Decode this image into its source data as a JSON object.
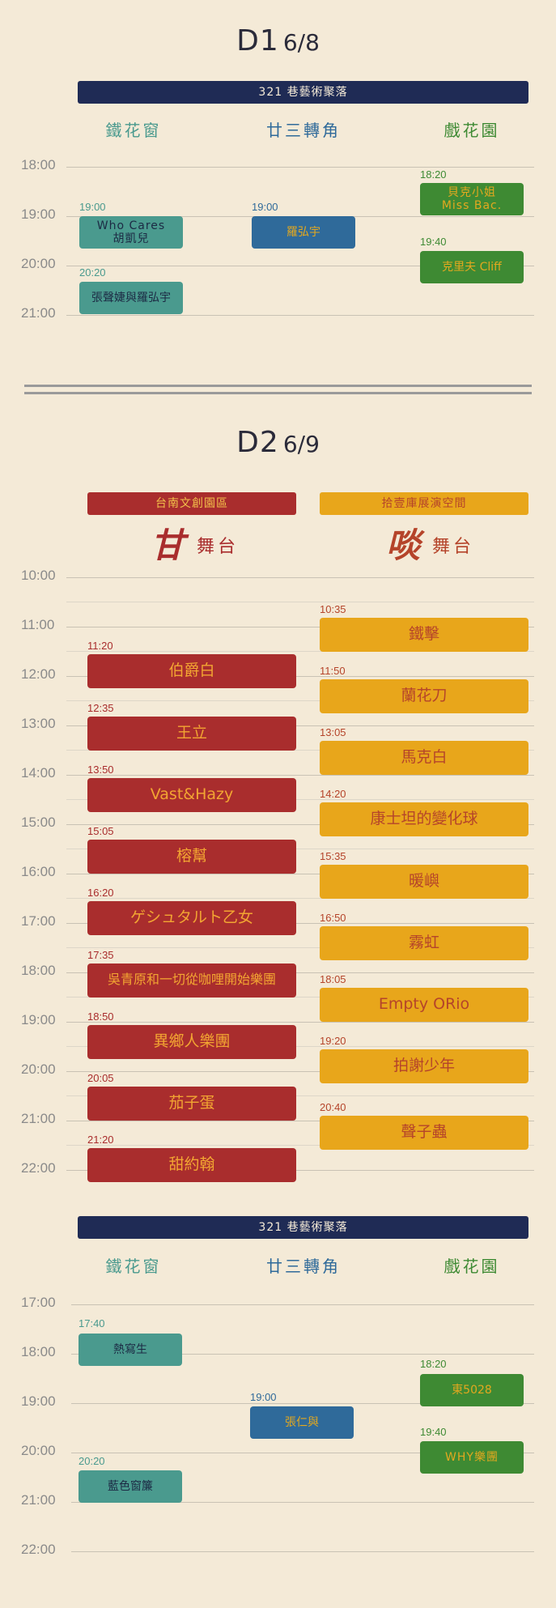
{
  "d1": {
    "title": "D1",
    "date": "6/8",
    "venue": "321 巷藝術聚落",
    "stages": [
      "鐵花窗",
      "廿三轉角",
      "戲花園"
    ],
    "times": [
      "18:00",
      "19:00",
      "20:00",
      "21:00"
    ],
    "slots": [
      {
        "time": "19:00",
        "line1": "Who Cares",
        "line2": "胡凱兒"
      },
      {
        "time": "20:20",
        "line1": "張聲婕與羅弘宇"
      },
      {
        "time": "19:00",
        "line1": "羅弘宇"
      },
      {
        "time": "18:20",
        "line1": "貝克小姐",
        "line2": "Miss Bac."
      },
      {
        "time": "19:40",
        "line1": "克里夫 Cliff"
      }
    ]
  },
  "d2": {
    "title": "D2",
    "date": "6/9",
    "venue_left": "台南文創園區",
    "venue_right": "拾壹庫展演空間",
    "stage_left_glyph": "甘",
    "stage_left_name": "舞台",
    "stage_right_glyph": "啖",
    "stage_right_name": "舞台",
    "times": [
      "10:00",
      "11:00",
      "12:00",
      "13:00",
      "14:00",
      "15:00",
      "16:00",
      "17:00",
      "18:00",
      "19:00",
      "20:00",
      "21:00",
      "22:00"
    ],
    "left": [
      {
        "time": "11:20",
        "name": "伯爵白"
      },
      {
        "time": "12:35",
        "name": "王立"
      },
      {
        "time": "13:50",
        "name": "Vast&Hazy"
      },
      {
        "time": "15:05",
        "name": "榕幫"
      },
      {
        "time": "16:20",
        "name": "ゲシュタルト乙女"
      },
      {
        "time": "17:35",
        "name": "吳青原和一切從咖哩開始樂團"
      },
      {
        "time": "18:50",
        "name": "異鄉人樂團"
      },
      {
        "time": "20:05",
        "name": "茄子蛋"
      },
      {
        "time": "21:20",
        "name": "甜約翰"
      }
    ],
    "right": [
      {
        "time": "10:35",
        "name": "鐵擊"
      },
      {
        "time": "11:50",
        "name": "蘭花刀"
      },
      {
        "time": "13:05",
        "name": "馬克白"
      },
      {
        "time": "14:20",
        "name": "康士坦的變化球"
      },
      {
        "time": "15:35",
        "name": "暖嶼"
      },
      {
        "time": "16:50",
        "name": "霧虹"
      },
      {
        "time": "18:05",
        "name": "Empty ORio"
      },
      {
        "time": "19:20",
        "name": "拍謝少年"
      },
      {
        "time": "20:40",
        "name": "聲子蟲"
      }
    ]
  },
  "d2b": {
    "venue": "321 巷藝術聚落",
    "stages": [
      "鐵花窗",
      "廿三轉角",
      "戲花園"
    ],
    "times": [
      "17:00",
      "18:00",
      "19:00",
      "20:00",
      "21:00",
      "22:00"
    ],
    "slots": [
      {
        "time": "17:40",
        "name": "熱寫生"
      },
      {
        "time": "20:20",
        "name": "藍色窗簾"
      },
      {
        "time": "19:00",
        "name": "張仁與"
      },
      {
        "time": "18:20",
        "name": "東5028"
      },
      {
        "time": "19:40",
        "name": "WHY樂團"
      }
    ]
  },
  "colors": {
    "background": "#f4ead7",
    "navy": "#1f2b55",
    "teal": "#4a9a8e",
    "blue": "#2f6a9a",
    "green": "#3e8a33",
    "red": "#a92d2d",
    "yellow": "#e8a61b"
  }
}
